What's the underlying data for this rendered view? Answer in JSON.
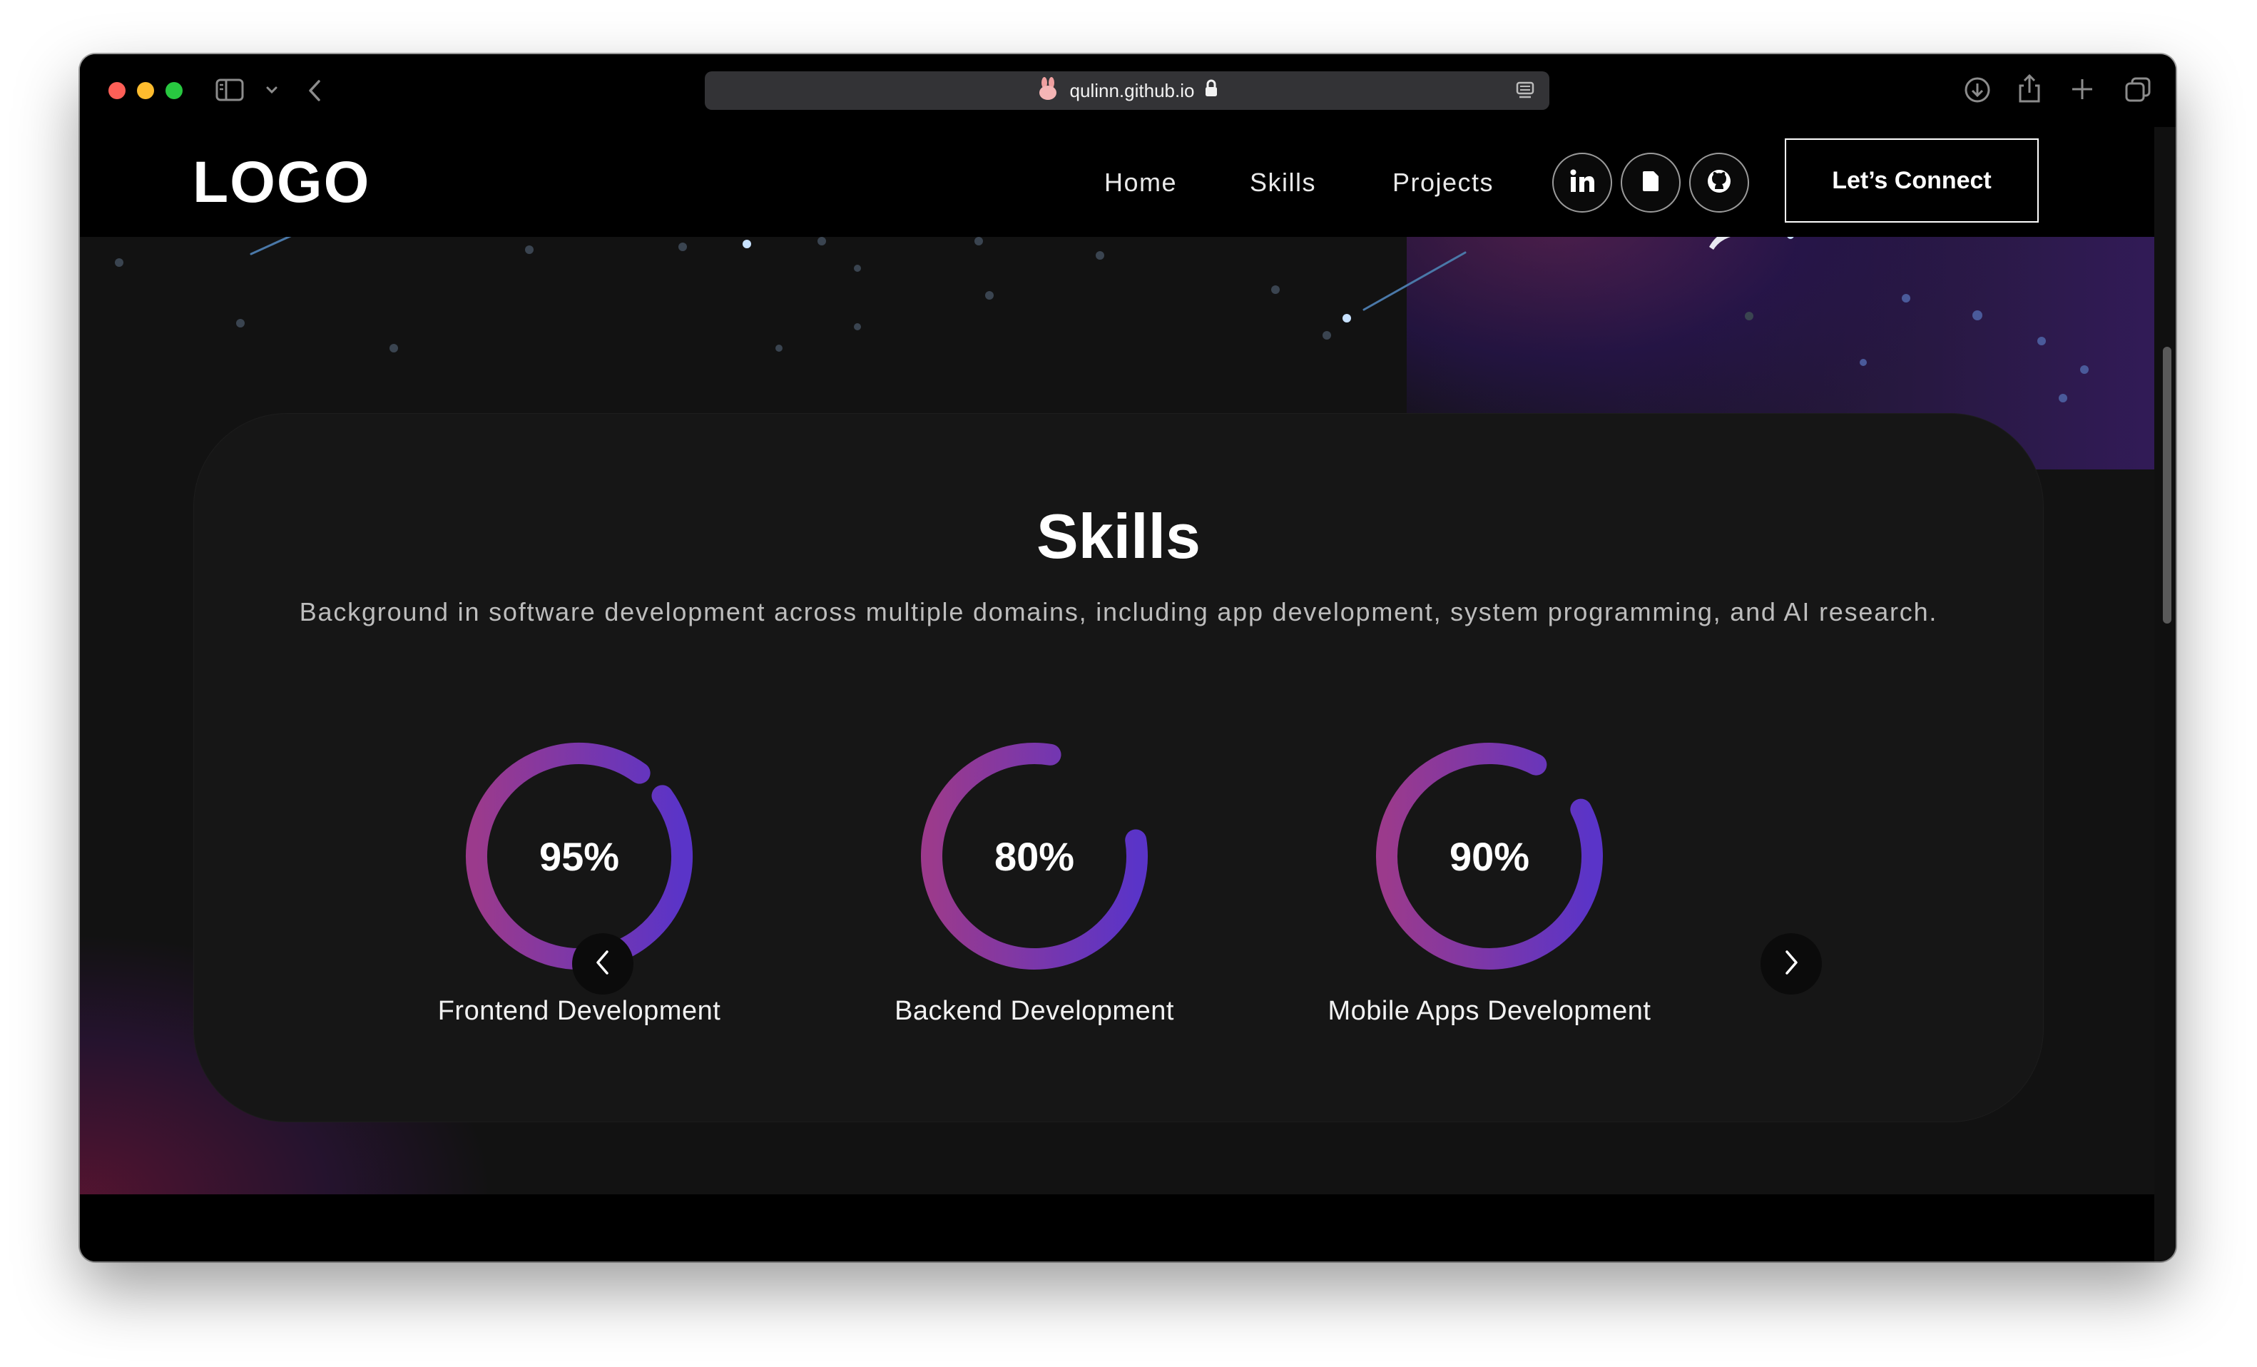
{
  "browser": {
    "url": "qulinn.github.io",
    "icons": [
      "sidebar-icon",
      "chevron-down-icon",
      "back-icon",
      "bunny-favicon",
      "lock-icon",
      "reader-icon",
      "download-icon",
      "share-icon",
      "plus-icon",
      "tabs-icon"
    ]
  },
  "nav": {
    "logo": "LOGO",
    "links": [
      "Home",
      "Skills",
      "Projects"
    ],
    "social": [
      "linkedin-icon",
      "document-icon",
      "github-icon"
    ],
    "cta": "Let’s Connect"
  },
  "skills": {
    "title": "Skills",
    "description": "Background in software development across multiple domains, including app development, system programming, and AI research.",
    "items": [
      {
        "name": "Frontend Development",
        "value_label": "95%",
        "value": 95
      },
      {
        "name": "Backend Development",
        "value_label": "80%",
        "value": 80
      },
      {
        "name": "Mobile Apps Development",
        "value_label": "90%",
        "value": 90
      }
    ]
  },
  "colors": {
    "ring_start": "#9b3a8c",
    "ring_end": "#5a34c8",
    "page_bg": "#121212",
    "card_bg": "#161616"
  }
}
